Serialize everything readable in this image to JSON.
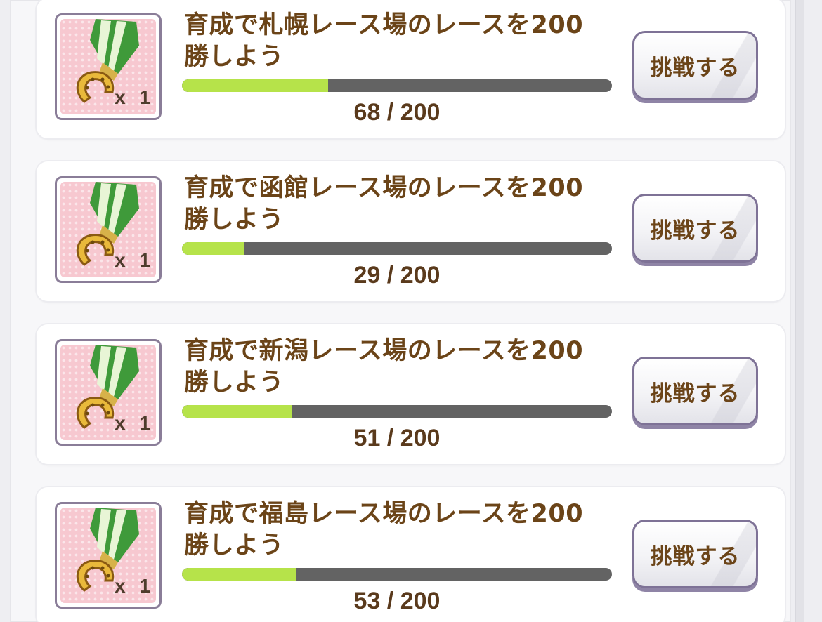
{
  "missions": [
    {
      "title": "育成で札幌レース場のレースを200勝しよう",
      "reward_quantity": "x 1",
      "reward_icon": "horseshoe-medal-icon",
      "progress_current": 68,
      "progress_total": 200,
      "progress_text": "68 / 200",
      "button_label": "挑戦する"
    },
    {
      "title": "育成で函館レース場のレースを200勝しよう",
      "reward_quantity": "x 1",
      "reward_icon": "horseshoe-medal-icon",
      "progress_current": 29,
      "progress_total": 200,
      "progress_text": "29 / 200",
      "button_label": "挑戦する"
    },
    {
      "title": "育成で新潟レース場のレースを200勝しよう",
      "reward_quantity": "x 1",
      "reward_icon": "horseshoe-medal-icon",
      "progress_current": 51,
      "progress_total": 200,
      "progress_text": "51 / 200",
      "button_label": "挑戦する"
    },
    {
      "title": "育成で福島レース場のレースを200勝しよう",
      "reward_quantity": "x 1",
      "reward_icon": "horseshoe-medal-icon",
      "progress_current": 53,
      "progress_total": 200,
      "progress_text": "53 / 200",
      "button_label": "挑戦する"
    }
  ],
  "colors": {
    "progress_fill": "#b6e34a",
    "progress_track": "#636363",
    "title_text": "#6b4418",
    "reward_background": "#f7c8d0",
    "button_border": "#7e7296"
  }
}
